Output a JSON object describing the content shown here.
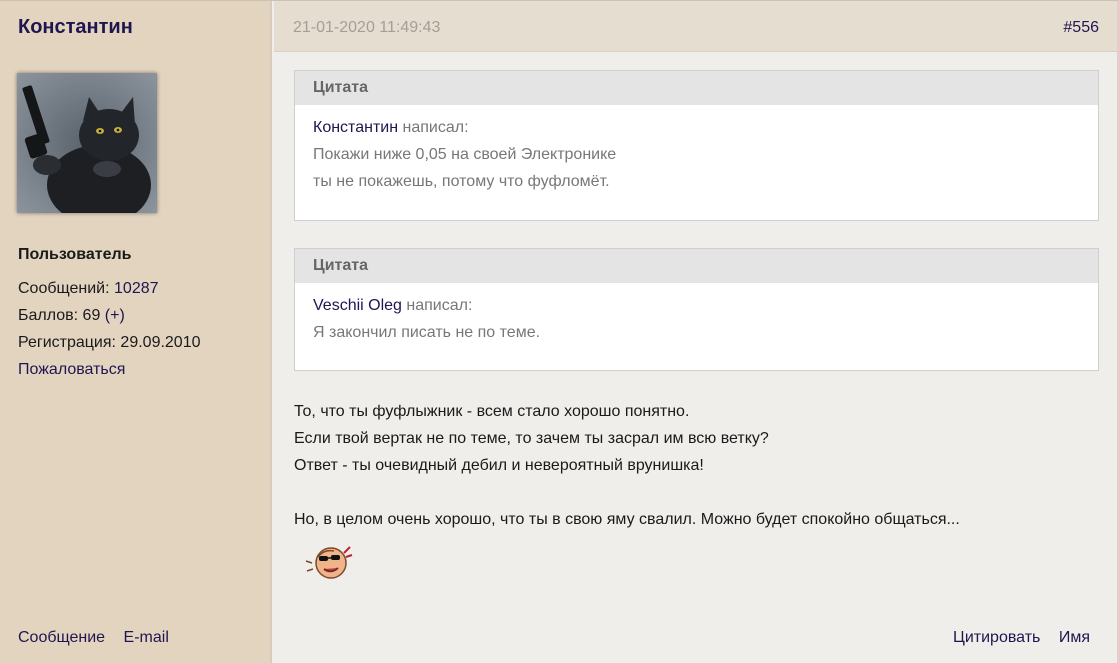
{
  "author": {
    "name": "Константин",
    "avatar_icon": "cat-with-gun-avatar",
    "role": "Пользователь",
    "posts_label": "Сообщений:",
    "posts_value": "10287",
    "points_label": "Баллов: 69",
    "points_plus": "(+)",
    "registration_label": "Регистрация: 29.09.2010",
    "report_link": "Пожаловаться",
    "message_link": "Сообщение",
    "email_link": "E-mail"
  },
  "post": {
    "date": "21-01-2020 11:49:43",
    "number": "#556",
    "quotes": [
      {
        "header": "Цитата",
        "author": "Константин",
        "wrote": " написал:",
        "lines": [
          "Покажи ниже 0,05 на своей Электронике",
          "ты не покажешь, потому что фуфломёт."
        ]
      },
      {
        "header": "Цитата",
        "author": "Veschii Oleg",
        "wrote": " написал:",
        "lines": [
          "Я закончил писать не по теме."
        ]
      }
    ],
    "message_lines": [
      "То, что ты фуфлыжник - всем стало хорошо понятно.",
      "Если твой вертак не по теме, то зачем ты засрал им всю ветку?",
      "Ответ - ты очевидный дебил и невероятный врунишка!",
      "Но, в целом очень хорошо, что ты в свою яму свалил. Можно будет спокойно общаться..."
    ],
    "smiley_icon": "cool-sunglasses-smiley-icon",
    "quote_action": "Цитировать",
    "name_action": "Имя"
  },
  "colors": {
    "author_bg": "#e3d4c0",
    "content_bg": "#f0eeeb",
    "header_bg": "#e6ddd1",
    "link": "#1f1650",
    "quote_header_bg": "#e4e4e4"
  }
}
